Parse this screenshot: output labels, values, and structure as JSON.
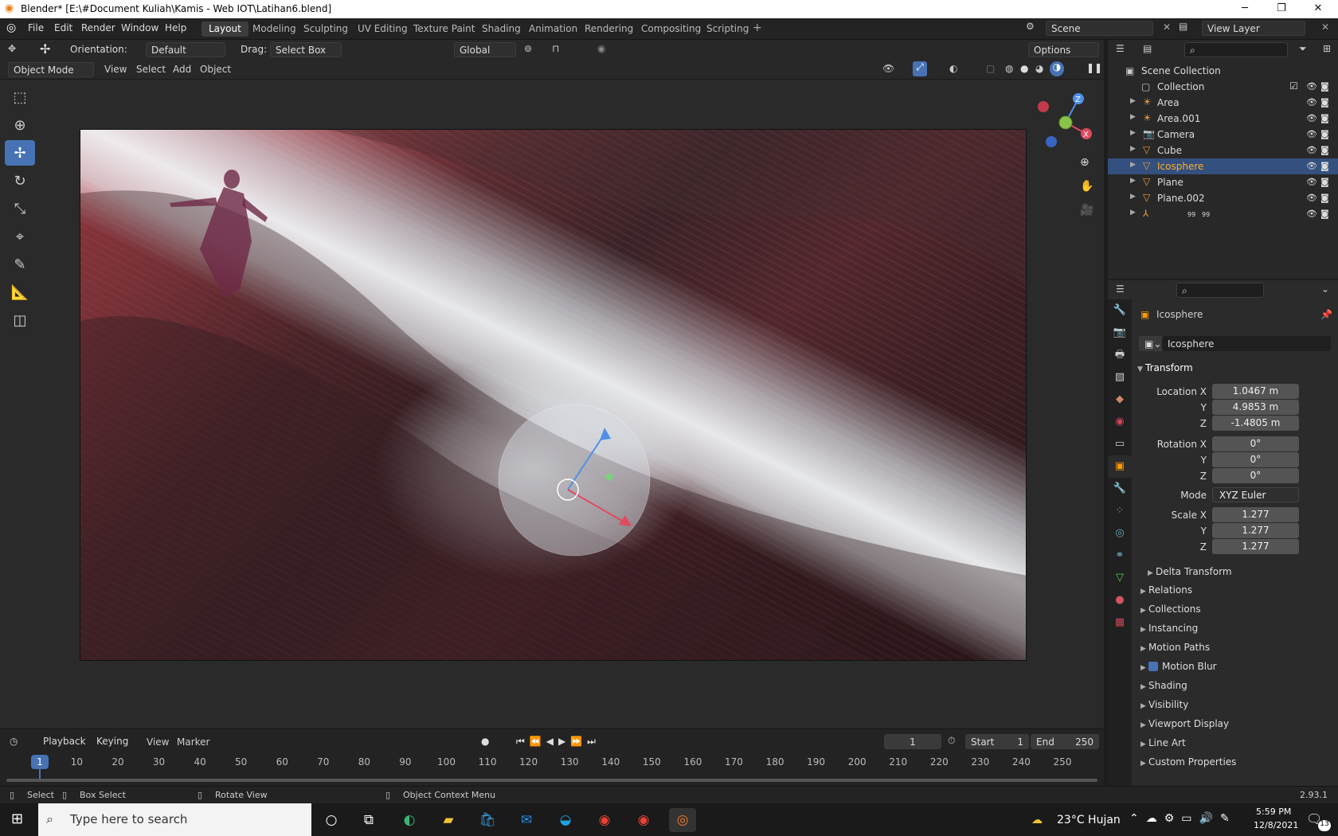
{
  "window": {
    "title": "Blender* [E:\\#Document Kuliah\\Kamis - Web IOT\\Latihan6.blend]",
    "minimize": "─",
    "restore": "❐",
    "close": "✕"
  },
  "menu": [
    "File",
    "Edit",
    "Render",
    "Window",
    "Help"
  ],
  "workspaces": [
    "Layout",
    "Modeling",
    "Sculpting",
    "UV Editing",
    "Texture Paint",
    "Shading",
    "Animation",
    "Rendering",
    "Compositing",
    "Scripting"
  ],
  "scene": {
    "name": "Scene",
    "view_layer": "View Layer"
  },
  "tool_header": {
    "orientation_label": "Orientation:",
    "orientation_value": "Default",
    "drag_label": "Drag:",
    "drag_value": "Select Box",
    "transform": "Global",
    "options": "Options"
  },
  "view_header": {
    "mode": "Object Mode",
    "items": [
      "View",
      "Select",
      "Add",
      "Object"
    ]
  },
  "outliner": {
    "scene_collection": "Scene Collection",
    "collection": "Collection",
    "items": [
      {
        "name": "Area",
        "icon": "light-icon"
      },
      {
        "name": "Area.001",
        "icon": "light-icon"
      },
      {
        "name": "Camera",
        "icon": "camera-icon"
      },
      {
        "name": "Cube",
        "icon": "mesh-icon"
      },
      {
        "name": "Icosphere",
        "icon": "mesh-icon",
        "selected": true
      },
      {
        "name": "Plane",
        "icon": "mesh-icon"
      },
      {
        "name": "Plane.002",
        "icon": "mesh-icon"
      },
      {
        "name": "",
        "icon": "armature-icon",
        "badge1": "99",
        "badge2": "99"
      }
    ]
  },
  "properties": {
    "object_name": "Icosphere",
    "datablock": "Icosphere",
    "transform": "Transform",
    "location": {
      "label": "Location X",
      "x": "1.0467 m",
      "y": "4.9853 m",
      "z": "-1.4805 m"
    },
    "rotation": {
      "label": "Rotation X",
      "x": "0°",
      "y": "0°",
      "z": "0°"
    },
    "mode_label": "Mode",
    "mode_value": "XYZ Euler",
    "scale": {
      "label": "Scale X",
      "x": "1.277",
      "y": "1.277",
      "z": "1.277"
    },
    "axis_y": "Y",
    "axis_z": "Z",
    "delta": "Delta Transform",
    "sections": [
      "Relations",
      "Collections",
      "Instancing",
      "Motion Paths",
      "Motion Blur",
      "Shading",
      "Visibility",
      "Viewport Display",
      "Line Art",
      "Custom Properties"
    ]
  },
  "timeline": {
    "menus": [
      "Playback",
      "Keying",
      "View",
      "Marker"
    ],
    "current_frame": "1",
    "start_label": "Start",
    "start": "1",
    "end_label": "End",
    "end": "250",
    "ticks": [
      "1",
      "10",
      "20",
      "30",
      "40",
      "50",
      "60",
      "70",
      "80",
      "90",
      "100",
      "110",
      "120",
      "130",
      "140",
      "150",
      "160",
      "170",
      "180",
      "190",
      "200",
      "210",
      "220",
      "230",
      "240",
      "250"
    ]
  },
  "statusbar": {
    "select": "Select",
    "box_select": "Box Select",
    "rotate": "Rotate View",
    "context": "Object Context Menu",
    "version": "2.93.1"
  },
  "taskbar": {
    "search": "Type here to search",
    "weather": "23°C  Hujan",
    "time": "5:59 PM",
    "date": "12/8/2021",
    "notif": "13"
  }
}
